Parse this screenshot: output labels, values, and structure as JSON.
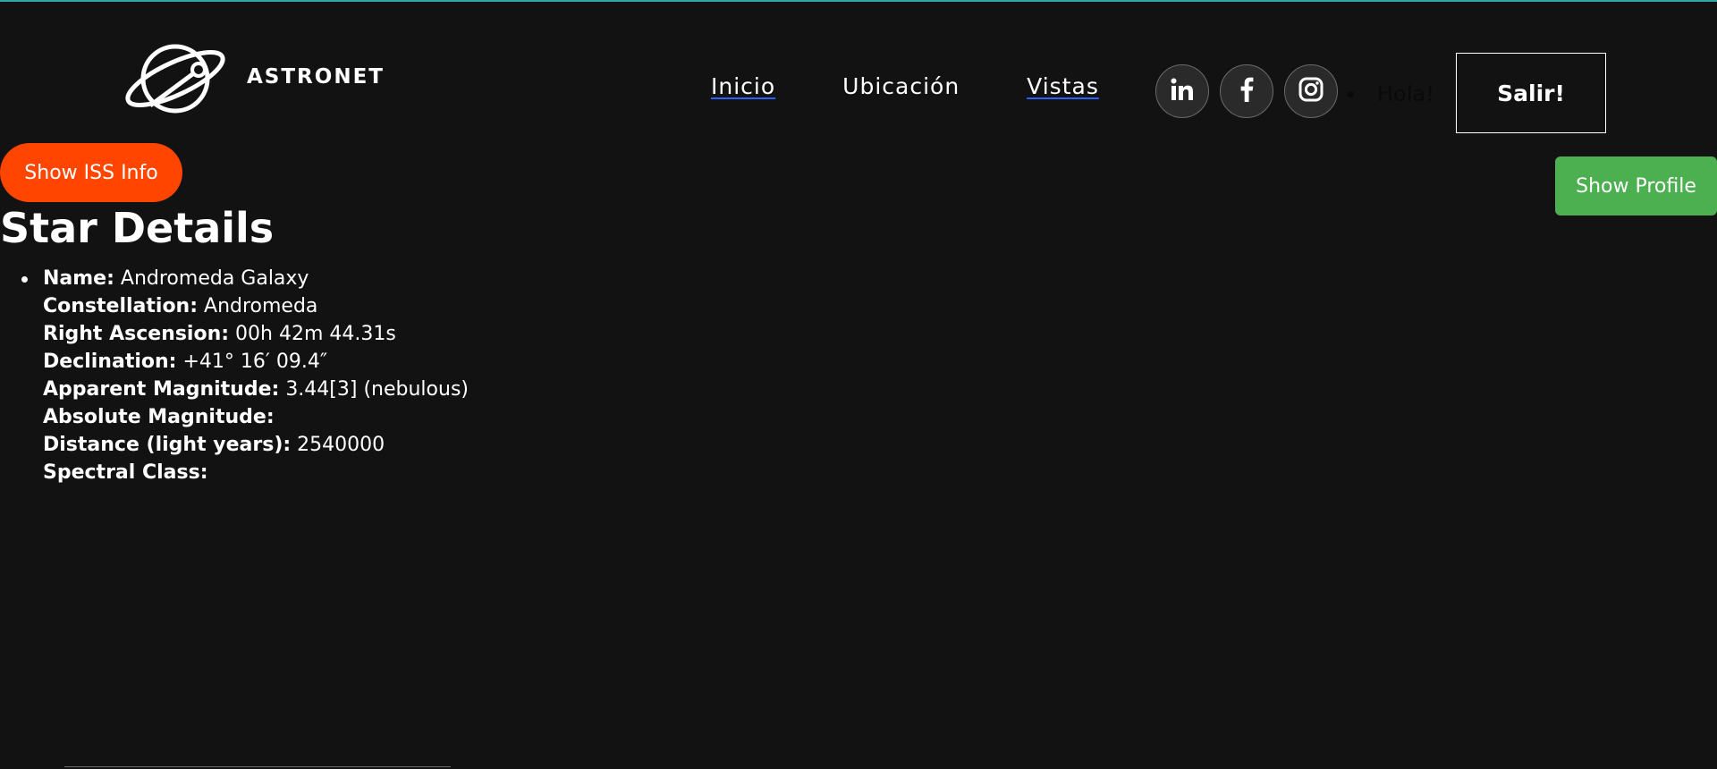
{
  "brand": {
    "name": "ASTRONET",
    "logo_icon": "planet-orbit-icon"
  },
  "nav": {
    "items": [
      {
        "label": "Inicio"
      },
      {
        "label": "Ubicación"
      },
      {
        "label": "Vistas"
      }
    ]
  },
  "social": {
    "linkedin_icon": "linkedin-icon",
    "facebook_icon": "facebook-icon",
    "instagram_icon": "instagram-icon"
  },
  "header": {
    "greeting": "Hola!",
    "logout_label": "Salir!"
  },
  "actions": {
    "iss_label": "Show ISS Info",
    "profile_label": "Show Profile"
  },
  "star_details": {
    "title": "Star Details",
    "fields": [
      {
        "label": "Name:",
        "value": "Andromeda Galaxy"
      },
      {
        "label": "Constellation:",
        "value": "Andromeda"
      },
      {
        "label": "Right Ascension:",
        "value": "00h 42m 44.31s"
      },
      {
        "label": "Declination:",
        "value": "+41° 16′ 09.4″"
      },
      {
        "label": "Apparent Magnitude:",
        "value": "3.44[3] (nebulous)"
      },
      {
        "label": "Absolute Magnitude:",
        "value": ""
      },
      {
        "label": "Distance (light years):",
        "value": "2540000"
      },
      {
        "label": "Spectral Class:",
        "value": ""
      }
    ]
  },
  "colors": {
    "background": "#121212",
    "accent_line": "#2fa6a8",
    "iss_button": "#ff4500",
    "profile_button": "#4caf50",
    "link_underline": "#2962ff"
  }
}
